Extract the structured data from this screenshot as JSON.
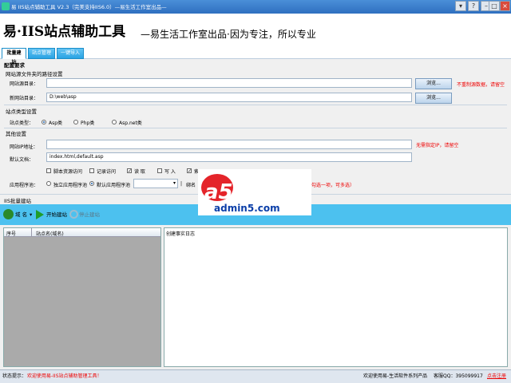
{
  "window": {
    "title": "易 IIS站点辅助工具 V2.3（完美支持IIS6.0）—易生活工作室出品—",
    "controls": {
      "menu": "▾",
      "help": "?",
      "minimize": "–",
      "maximize": "□",
      "close": "×"
    }
  },
  "header": {
    "logo": "易·IIS站点辅助工具",
    "slogan": "—易生活工作室出品·因为专注，所以专业"
  },
  "tabs": [
    {
      "label": "批量建站"
    },
    {
      "label": "站点管理"
    },
    {
      "label": "一键导入"
    }
  ],
  "config": {
    "legend": "配置要求",
    "dir_group": {
      "legend": "网站源文件夹的路径设置",
      "source_label": "网站源目录：",
      "source_value": "",
      "target_label": "新网站目录：",
      "target_value": "D:\\web\\asp",
      "browse_label": "浏览...",
      "source_hint": "不重制源数据，请留空"
    },
    "type_group": {
      "legend": "站点类型设置",
      "label": "站点类型：",
      "options": [
        "Asp类",
        "Php类",
        "Asp.net类"
      ],
      "selected": "Asp类"
    },
    "other_group": {
      "legend": "其他设置",
      "ip_label": "网站IP地址：",
      "ip_value": "",
      "ip_hint": "无需指定IP，请留空",
      "doc_label": "默认文档：",
      "doc_value": "index.html,default.asp",
      "checkboxes": [
        {
          "label": "脚本资源访问",
          "checked": false
        },
        {
          "label": "记录访问",
          "checked": false
        },
        {
          "label": "读 取",
          "checked": true
        },
        {
          "label": "写 入",
          "checked": false
        },
        {
          "label": "索",
          "checked": true
        }
      ],
      "pool_label": "应用程序池：",
      "pool_options": [
        "独立应用程序池",
        "默认应用程序池"
      ],
      "pool_selected": "默认应用程序池",
      "pool_select_value": "",
      "bind_label": "绑名",
      "multi_hint": "勾选一项，可多选）"
    }
  },
  "build": {
    "legend": "IIS批量建站",
    "toolbar": {
      "domain": "域 名",
      "start": "开始建站",
      "stop": "停止建站"
    },
    "list": {
      "columns": [
        "序号",
        "站点名(域名)"
      ]
    },
    "log": {
      "title": "创建事实日志"
    }
  },
  "statusbar": {
    "label": "状态提示：",
    "message": "欢迎使用易-IIS站点辅助管理工具！",
    "about": "欢迎使用易-生活软件系列产品",
    "qq": "客服QQ：395099917",
    "register": "点击注册"
  },
  "watermark": {
    "brand": "a5下载",
    "site": "admin5.com"
  },
  "colors": {
    "toolbar": "#4cc1ef",
    "hint": "#ee0000",
    "accent": "#2aa3e3"
  }
}
